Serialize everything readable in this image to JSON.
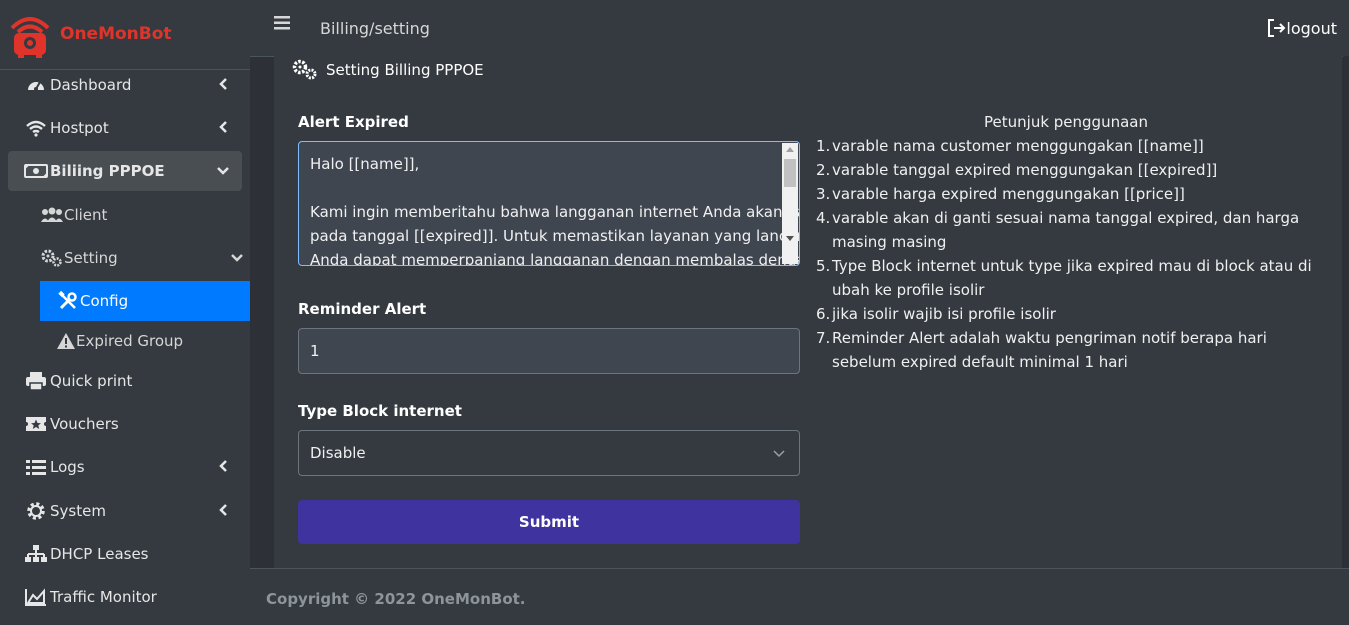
{
  "brand": {
    "name": "OneMonBot",
    "accent": "#e0342b"
  },
  "sidebar": {
    "items": [
      {
        "label": "Dashboard",
        "icon": "gauge-icon"
      },
      {
        "label": "Hostpot",
        "icon": "wifi-icon"
      },
      {
        "label": "Biliing PPPOE",
        "icon": "money-bill-icon"
      },
      {
        "label": "Quick print",
        "icon": "printer-icon"
      },
      {
        "label": "Vouchers",
        "icon": "ticket-icon"
      },
      {
        "label": "Logs",
        "icon": "list-icon"
      },
      {
        "label": "System",
        "icon": "gear-icon"
      },
      {
        "label": "DHCP Leases",
        "icon": "sitemap-icon"
      },
      {
        "label": "Traffic Monitor",
        "icon": "chart-area-icon"
      }
    ],
    "billing_sub": [
      {
        "label": "Client",
        "icon": "users-icon"
      },
      {
        "label": "Setting",
        "icon": "gears-icon"
      }
    ],
    "setting_sub": [
      {
        "label": "Config",
        "icon": "tools-icon"
      },
      {
        "label": "Expired Group",
        "icon": "warning-icon"
      }
    ]
  },
  "topbar": {
    "breadcrumb": "Billing/setting",
    "logout_label": "logout"
  },
  "card": {
    "title": "Setting Billing PPPOE",
    "alert_expired_label": "Alert Expired",
    "alert_expired_lines": [
      "Halo [[name]],",
      "",
      "Kami ingin memberitahu bahwa langganan internet Anda akan habis",
      "pada tanggal [[expired]]. Untuk memastikan layanan yang lancar,",
      "Anda dapat memperpanjang langganan dengan membalas dengan"
    ],
    "reminder_label": "Reminder Alert",
    "reminder_value": "1",
    "block_label": "Type Block internet",
    "block_value": "Disable",
    "submit_label": "Submit",
    "submit_color": "#3f33a0"
  },
  "guide": {
    "title": "Petunjuk penggunaan",
    "items": [
      "varable nama customer menggungakan [[name]]",
      "varable tanggal expired menggungakan [[expired]]",
      "varable harga expired menggungakan [[price]]",
      "varable akan di ganti sesuai nama tanggal expired, dan harga masing masing",
      "Type Block internet untuk type jika expired mau di block atau di ubah ke profile isolir",
      "jika isolir wajib isi profile isolir",
      "Reminder Alert adalah waktu pengriman notif berapa hari sebelum expired default minimal 1 hari"
    ]
  },
  "footer": {
    "copyright": "Copyright © 2022 OneMonBot."
  }
}
